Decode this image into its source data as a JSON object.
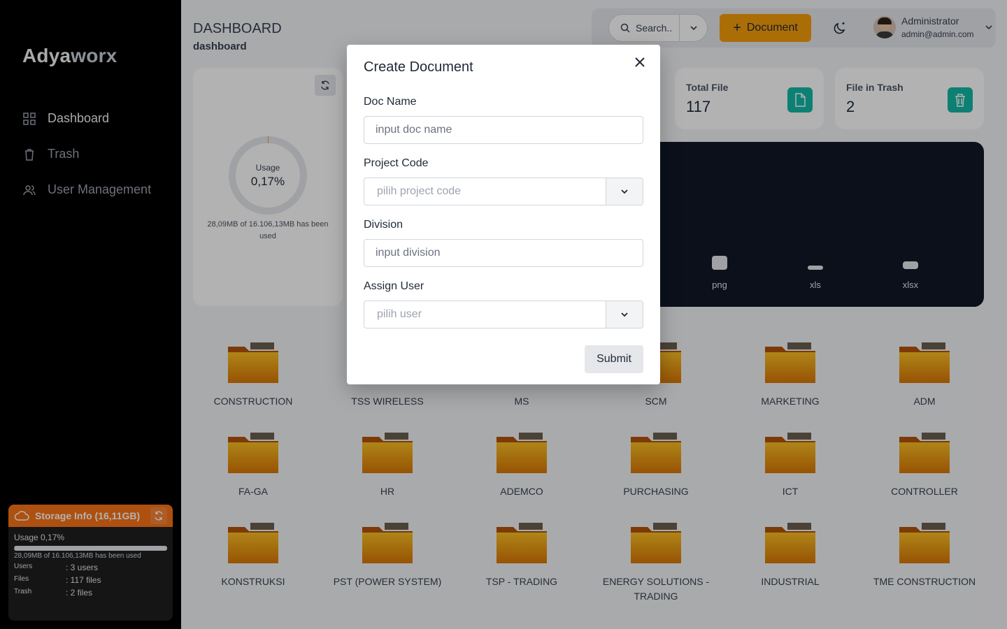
{
  "brand": {
    "part1": "Adya",
    "part2": "worx"
  },
  "sidebar": {
    "items": [
      {
        "label": "Dashboard",
        "icon": "grid-icon",
        "active": true
      },
      {
        "label": "Trash",
        "icon": "trash-icon",
        "active": false
      },
      {
        "label": "User Management",
        "icon": "users-icon",
        "active": false
      }
    ],
    "storage": {
      "title": "Storage Info (16,11GB)",
      "usage": "Usage 0,17%",
      "usage_fraction": 0.0017,
      "note": "28,09MB of 16.106,13MB has been used",
      "users_key": "Users",
      "users_val": ": 3 users",
      "files_key": "Files",
      "files_val": ": 117 files",
      "trash_key": "Trash",
      "trash_val": ": 2 files"
    }
  },
  "header": {
    "title": "DASHBOARD",
    "subtitle": "dashboard",
    "search_placeholder": "Search..",
    "add_document_label": "Document",
    "user_name": "Administrator",
    "user_email": "admin@admin.com"
  },
  "usage_card": {
    "label": "Usage",
    "value": "0,17%",
    "note": "28,09MB of 16.106,13MB has been used"
  },
  "stats": [
    {
      "label": "Total File",
      "value": "117",
      "icon": "file-icon"
    },
    {
      "label": "File in Trash",
      "value": "2",
      "icon": "trash-icon"
    }
  ],
  "file_types": [
    {
      "label": "png"
    },
    {
      "label": "xls"
    },
    {
      "label": "xlsx"
    }
  ],
  "folders": [
    "CONSTRUCTION",
    "TSS WIRELESS",
    "MS",
    "SCM",
    "MARKETING",
    "ADM",
    "FA-GA",
    "HR",
    "ADEMCO",
    "PURCHASING",
    "ICT",
    "CONTROLLER",
    "KONSTRUKSI",
    "PST (POWER SYSTEM)",
    "TSP - TRADING",
    "ENERGY SOLUTIONS - TRADING",
    "INDUSTRIAL",
    "TME CONSTRUCTION"
  ],
  "modal": {
    "title": "Create Document",
    "doc_name_label": "Doc Name",
    "doc_name_placeholder": "input doc name",
    "project_code_label": "Project Code",
    "project_code_placeholder": "pilih project code",
    "division_label": "Division",
    "division_placeholder": "input division",
    "assign_user_label": "Assign User",
    "assign_user_placeholder": "pilih user",
    "submit_label": "Submit"
  },
  "colors": {
    "accent": "#f59e0b",
    "teal": "#14b8a6",
    "sidebar": "#000000",
    "chart_bg": "#111827"
  }
}
